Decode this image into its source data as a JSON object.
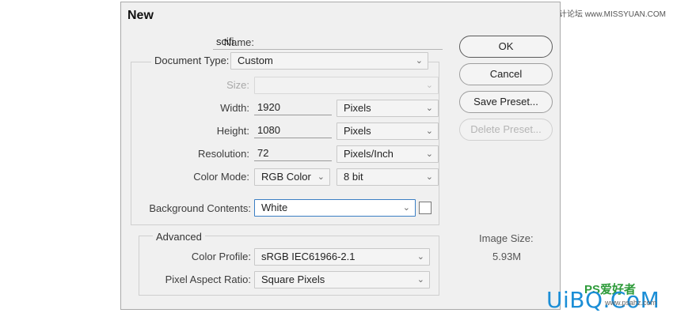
{
  "dialog": {
    "title": "New",
    "name": {
      "label": "Name:",
      "value": "scifi"
    },
    "document_type": {
      "label": "Document Type:",
      "value": "Custom"
    },
    "size": {
      "label": "Size:",
      "value": ""
    },
    "width": {
      "label": "Width:",
      "value": "1920",
      "unit": "Pixels"
    },
    "height": {
      "label": "Height:",
      "value": "1080",
      "unit": "Pixels"
    },
    "resolution": {
      "label": "Resolution:",
      "value": "72",
      "unit": "Pixels/Inch"
    },
    "color_mode": {
      "label": "Color Mode:",
      "value": "RGB Color",
      "depth": "8 bit"
    },
    "background_contents": {
      "label": "Background Contents:",
      "value": "White",
      "swatch_color": "#ffffff"
    },
    "advanced": {
      "title": "Advanced",
      "color_profile": {
        "label": "Color Profile:",
        "value": "sRGB IEC61966-2.1"
      },
      "pixel_aspect_ratio": {
        "label": "Pixel Aspect Ratio:",
        "value": "Square Pixels"
      }
    },
    "buttons": {
      "ok": "OK",
      "cancel": "Cancel",
      "save_preset": "Save Preset...",
      "delete_preset": "Delete Preset..."
    },
    "image_size": {
      "label": "Image Size:",
      "value": "5.93M"
    }
  },
  "watermark": {
    "top_right": "思缘设计论坛 www.MISSYUAN.COM",
    "bottom_logo": "UiBQ.CoM",
    "bottom_mark": "PS爱好者",
    "bottom_small": "www.psahz.com"
  },
  "icons": {
    "dropdown": "chevron-down-icon"
  }
}
